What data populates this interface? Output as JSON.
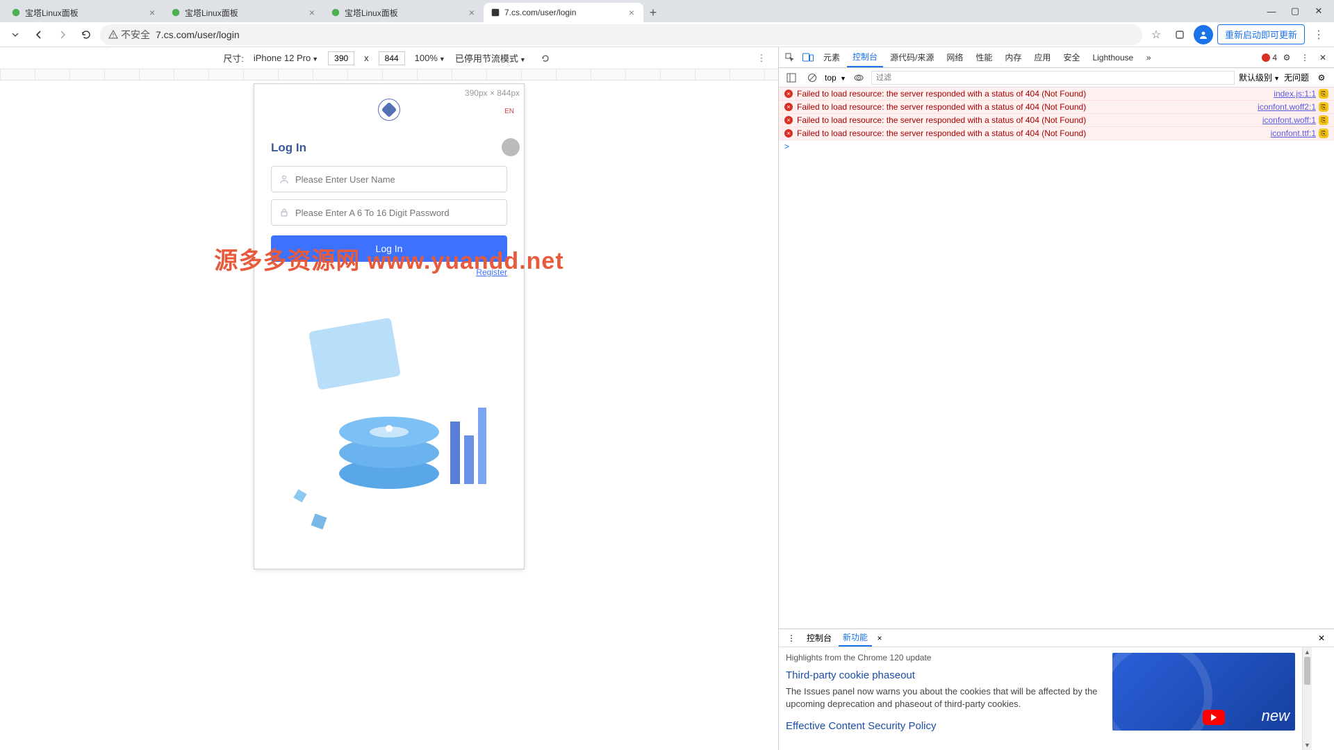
{
  "browser": {
    "tabs": [
      {
        "title": "宝塔Linux面板"
      },
      {
        "title": "宝塔Linux面板"
      },
      {
        "title": "宝塔Linux面板"
      },
      {
        "title": "7.cs.com/user/login"
      }
    ],
    "url_security": "不安全",
    "url": "7.cs.com/user/login",
    "relaunch": "重新启动即可更新"
  },
  "device_toolbar": {
    "label_prefix": "尺寸:",
    "device": "iPhone 12 Pro",
    "width": "390",
    "sep": "x",
    "height": "844",
    "zoom": "100%",
    "throttle": "已停用节流模式"
  },
  "device_frame": {
    "dim_text": "390px × 844px"
  },
  "login": {
    "lang": "EN",
    "title": "Log In",
    "user_placeholder": "Please Enter User Name",
    "pass_placeholder": "Please Enter A 6 To 16 Digit Password",
    "login_btn": "Log In",
    "register": "Register"
  },
  "watermark": "源多多资源网 www.yuandd.net",
  "devtools": {
    "tabs": {
      "elements": "元素",
      "console": "控制台",
      "sources": "源代码/来源",
      "network": "网络",
      "performance": "性能",
      "memory": "内存",
      "application": "应用",
      "security": "安全",
      "lighthouse": "Lighthouse"
    },
    "error_count": "4",
    "console_bar": {
      "top": "top",
      "filter_placeholder": "过滤",
      "levels": "默认级别",
      "issues": "无问题"
    },
    "errors": [
      {
        "msg": "Failed to load resource: the server responded with a status of 404 (Not Found)",
        "src": "index.js:1:1"
      },
      {
        "msg": "Failed to load resource: the server responded with a status of 404 (Not Found)",
        "src": "iconfont.woff2:1"
      },
      {
        "msg": "Failed to load resource: the server responded with a status of 404 (Not Found)",
        "src": "iconfont.woff:1"
      },
      {
        "msg": "Failed to load resource: the server responded with a status of 404 (Not Found)",
        "src": "iconfont.ttf:1"
      }
    ],
    "prompt": ">",
    "drawer": {
      "tab_console": "控制台",
      "tab_new": "新功能",
      "subtitle": "Highlights from the Chrome 120 update",
      "h1": "Third-party cookie phaseout",
      "p1": "The Issues panel now warns you about the cookies that will be affected by the upcoming deprecation and phaseout of third-party cookies.",
      "h2": "Effective Content Security Policy",
      "video_label": "new"
    }
  }
}
